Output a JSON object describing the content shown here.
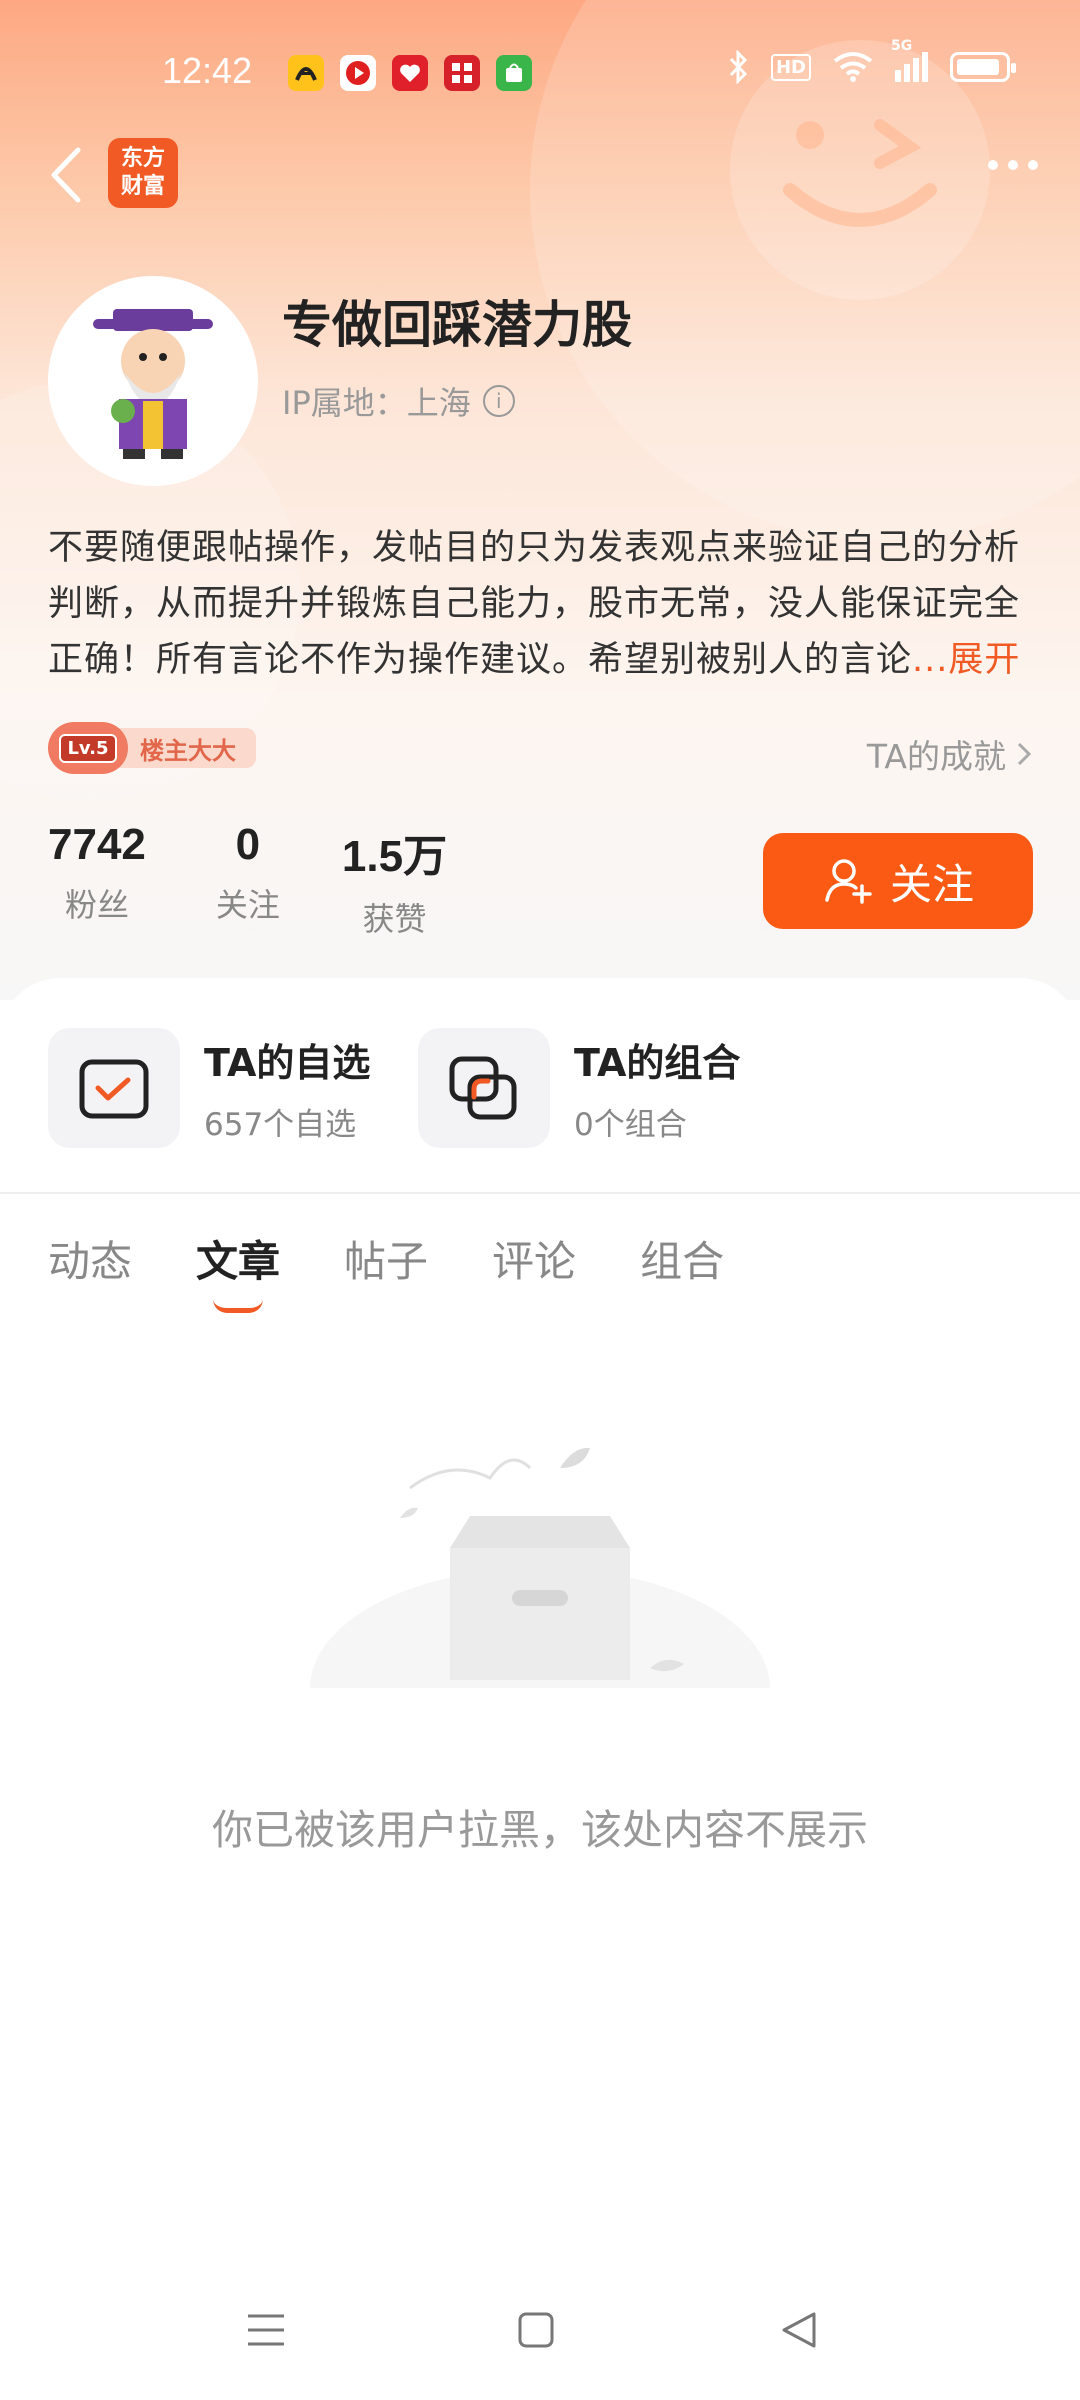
{
  "status_bar": {
    "time": "12:42",
    "network": "5G",
    "hd": "HD"
  },
  "nav": {
    "logo_line1": "东方",
    "logo_line2": "财富"
  },
  "profile": {
    "username": "专做回踩潜力股",
    "ip_location": "IP属地：上海",
    "bio": "不要随便跟帖操作，发帖目的只为发表观点来验证自己的分析判断，从而提升并锻炼自己能力，股市无常，没人能保证完全正确！所有言论不作为操作建议。希望别被别人的言论",
    "bio_more": "...展开",
    "level": "Lv.5",
    "level_title": "楼主大大",
    "achievements": "TA的成就"
  },
  "stats": [
    {
      "value": "7742",
      "label": "粉丝"
    },
    {
      "value": "0",
      "label": "关注"
    },
    {
      "value": "1.5万",
      "label": "获赞"
    }
  ],
  "follow_button": "关注",
  "quick_links": [
    {
      "title": "TA的自选",
      "sub": "657个自选"
    },
    {
      "title": "TA的组合",
      "sub": "0个组合"
    }
  ],
  "tabs": [
    "动态",
    "文章",
    "帖子",
    "评论",
    "组合"
  ],
  "active_tab": "文章",
  "empty_message": "你已被该用户拉黑，该处内容不展示",
  "colors": {
    "accent": "#fa5a14",
    "brand": "#f15a24"
  }
}
